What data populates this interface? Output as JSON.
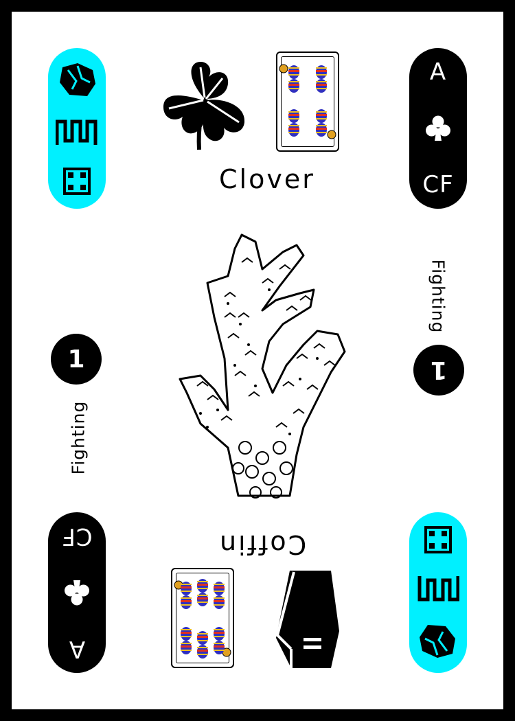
{
  "card": {
    "top_left_pill": {
      "icons": [
        "rock-icon",
        "meander-icon",
        "die-four-icon"
      ],
      "color": "#00f0ff"
    },
    "top_right_pill": {
      "rank": "A",
      "suit_icon": "club-icon",
      "code": "CF",
      "color": "#000000"
    },
    "bottom_left_pill": {
      "rank": "A",
      "suit_icon": "club-icon",
      "code": "CF",
      "color": "#000000"
    },
    "bottom_right_pill": {
      "icons": [
        "die-four-icon",
        "meander-icon",
        "rock-icon"
      ],
      "color": "#00f0ff"
    },
    "top_symbol": {
      "icon": "clover-icon",
      "label": "Clover",
      "playing_card_icon": "eight-of-bells-card-icon"
    },
    "bottom_symbol": {
      "icon": "coffin-icon",
      "label": "Coffin",
      "playing_card_icon": "nine-of-bells-card-icon"
    },
    "left_badge": {
      "number": "1",
      "label": "Fighting"
    },
    "right_badge": {
      "number": "1",
      "label": "Fighting"
    },
    "center_illustration": "coral-illustration",
    "accent_color": "#00f0ff"
  }
}
